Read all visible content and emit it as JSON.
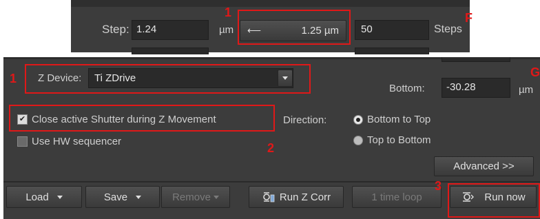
{
  "top": {
    "step_label": "Step:",
    "step_value": "1.24",
    "step_unit": "µm",
    "arrow_glyph": "⟵",
    "step_display": "1.25 µm",
    "steps_value": "50",
    "steps_label": "Steps"
  },
  "main": {
    "zdevice_label": "Z Device:",
    "zdevice_value": "Ti ZDrive",
    "bottom_label": "Bottom:",
    "bottom_value": "-30.28",
    "bottom_unit": "µm",
    "close_shutter_label": "Close active Shutter during Z Movement",
    "close_shutter_checked": true,
    "hw_sequencer_label": "Use HW sequencer",
    "hw_sequencer_checked": false,
    "direction_label": "Direction:",
    "direction_options": [
      "Bottom to Top",
      "Top to Bottom"
    ],
    "direction_selected": "Bottom to Top",
    "advanced_label": "Advanced >>"
  },
  "toolbar": {
    "load_label": "Load",
    "save_label": "Save",
    "remove_label": "Remove",
    "run_z_corr_label": "Run Z Corr",
    "time_loop_label": "1 time loop",
    "run_now_label": "Run now"
  },
  "annotations": {
    "marker_1a": "1",
    "marker_f": "F",
    "marker_1b": "1",
    "marker_g": "G",
    "marker_2": "2",
    "marker_3": "3"
  },
  "colors": {
    "panel_bg": "#3c3c3c",
    "annotation_red": "#e01818"
  }
}
